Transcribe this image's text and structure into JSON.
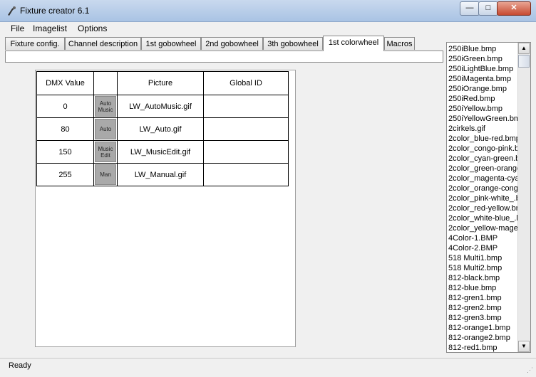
{
  "window": {
    "title": "Fixture creator 6.1",
    "minimize_glyph": "—",
    "maximize_glyph": "□",
    "close_glyph": "✕"
  },
  "menu": [
    "File",
    "Imagelist",
    "Options"
  ],
  "tabs": [
    {
      "label": "Fixture config."
    },
    {
      "label": "Channel description"
    },
    {
      "label": "1st gobowheel"
    },
    {
      "label": "2nd gobowheel"
    },
    {
      "label": "3th gobowheel"
    },
    {
      "label": "1st colorwheel",
      "active": true
    },
    {
      "label": "Macros"
    }
  ],
  "grid": {
    "headers": [
      "DMX Value",
      "",
      "Picture",
      "Global ID"
    ],
    "rows": [
      {
        "dmx": "0",
        "thumb": "Auto\nMusic",
        "picture": "LW_AutoMusic.gif",
        "global_id": ""
      },
      {
        "dmx": "80",
        "thumb": "Auto",
        "picture": "LW_Auto.gif",
        "global_id": ""
      },
      {
        "dmx": "150",
        "thumb": "Music\nEdit",
        "picture": "LW_MusicEdit.gif",
        "global_id": ""
      },
      {
        "dmx": "255",
        "thumb": "Man",
        "picture": "LW_Manual.gif",
        "global_id": ""
      }
    ]
  },
  "image_list": [
    "250iBlue.bmp",
    "250iGreen.bmp",
    "250iLightBlue.bmp",
    "250iMagenta.bmp",
    "250iOrange.bmp",
    "250iRed.bmp",
    "250iYellow.bmp",
    "250iYellowGreen.bmp",
    "2cirkels.gif",
    "2color_blue-red.bmp",
    "2color_congo-pink.bmp",
    "2color_cyan-green.bmp",
    "2color_green-orange.bmp",
    "2color_magenta-cyan.bmp",
    "2color_orange-congo.bmp",
    "2color_pink-white_.bmp",
    "2color_red-yellow.bmp",
    "2color_white-blue_.bmp",
    "2color_yellow-magenta.bmp",
    "4Color-1.BMP",
    "4Color-2.BMP",
    "518 Multi1.bmp",
    "518 Multi2.bmp",
    "812-black.bmp",
    "812-blue.bmp",
    "812-gren1.bmp",
    "812-gren2.bmp",
    "812-gren3.bmp",
    "812-orange1.bmp",
    "812-orange2.bmp",
    "812-red1.bmp"
  ],
  "scrollbar": {
    "up_glyph": "▲",
    "down_glyph": "▼"
  },
  "status": {
    "text": "Ready",
    "grip_glyph": "⋰"
  },
  "colors": {
    "titlebar": "#b9cfe9",
    "thumb_bg": "#a9a9a9"
  }
}
